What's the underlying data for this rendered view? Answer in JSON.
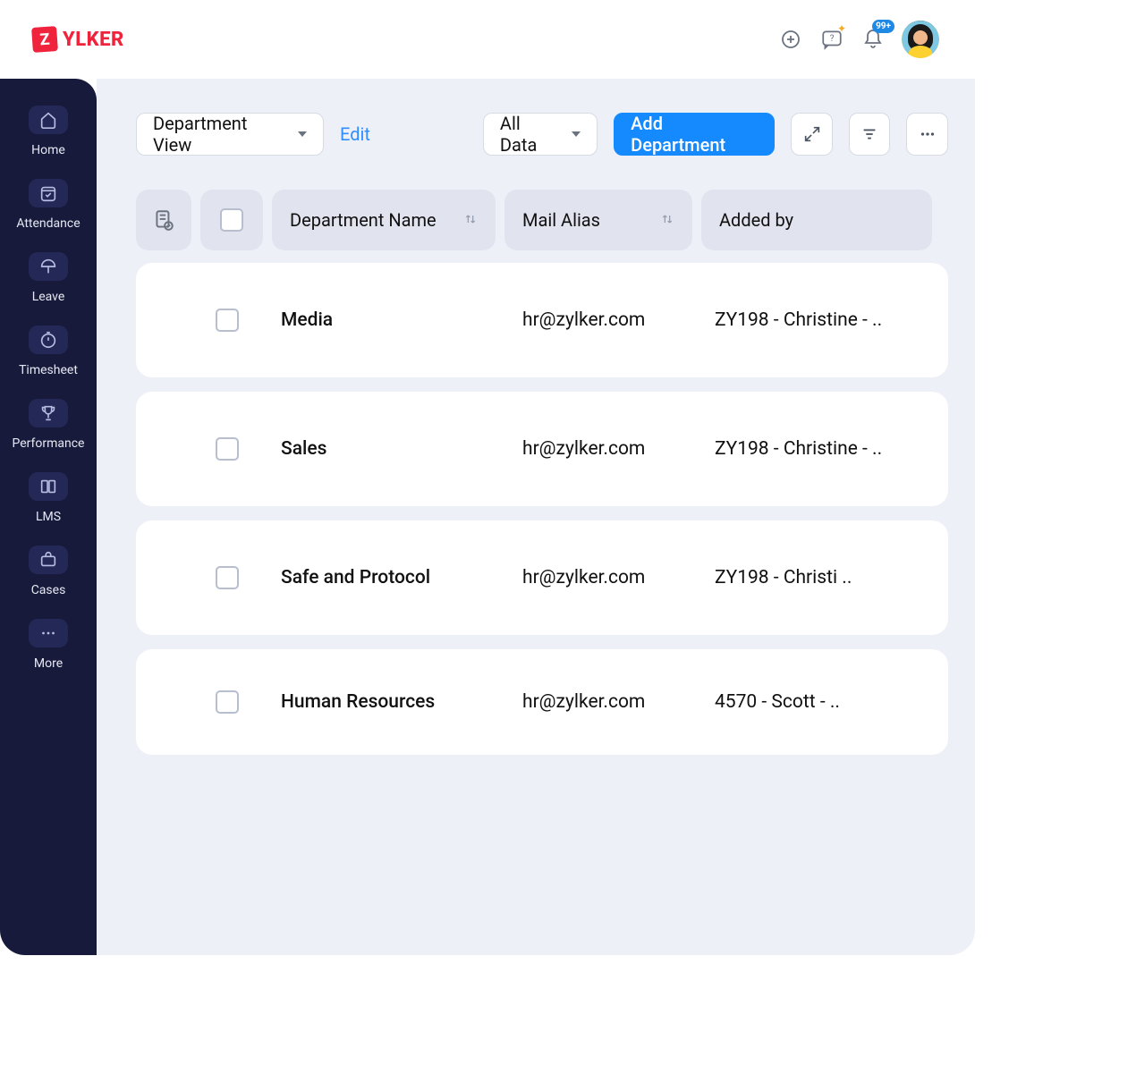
{
  "brand": {
    "tile": "Z",
    "name": "YLKER"
  },
  "topbar": {
    "notif_badge": "99+"
  },
  "sidebar": {
    "items": [
      "Home",
      "Attendance",
      "Leave",
      "Timesheet",
      "Performance",
      "LMS",
      "Cases",
      "More"
    ]
  },
  "toolbar": {
    "view_dropdown": "Department View",
    "edit": "Edit",
    "filter_dropdown": "All Data",
    "add_button": "Add Department"
  },
  "table": {
    "columns": {
      "name": "Department Name",
      "mail": "Mail Alias",
      "added": "Added by"
    },
    "rows": [
      {
        "name": "Media",
        "mail": "hr@zylker.com",
        "added": "ZY198 - Christine - .."
      },
      {
        "name": "Sales",
        "mail": "hr@zylker.com",
        "added": "ZY198 - Christine - .."
      },
      {
        "name": "Safe and Protocol",
        "mail": "hr@zylker.com",
        "added": "ZY198 - Christi .."
      },
      {
        "name": "Human Resources",
        "mail": "hr@zylker.com",
        "added": "4570 - Scott - .."
      }
    ]
  }
}
